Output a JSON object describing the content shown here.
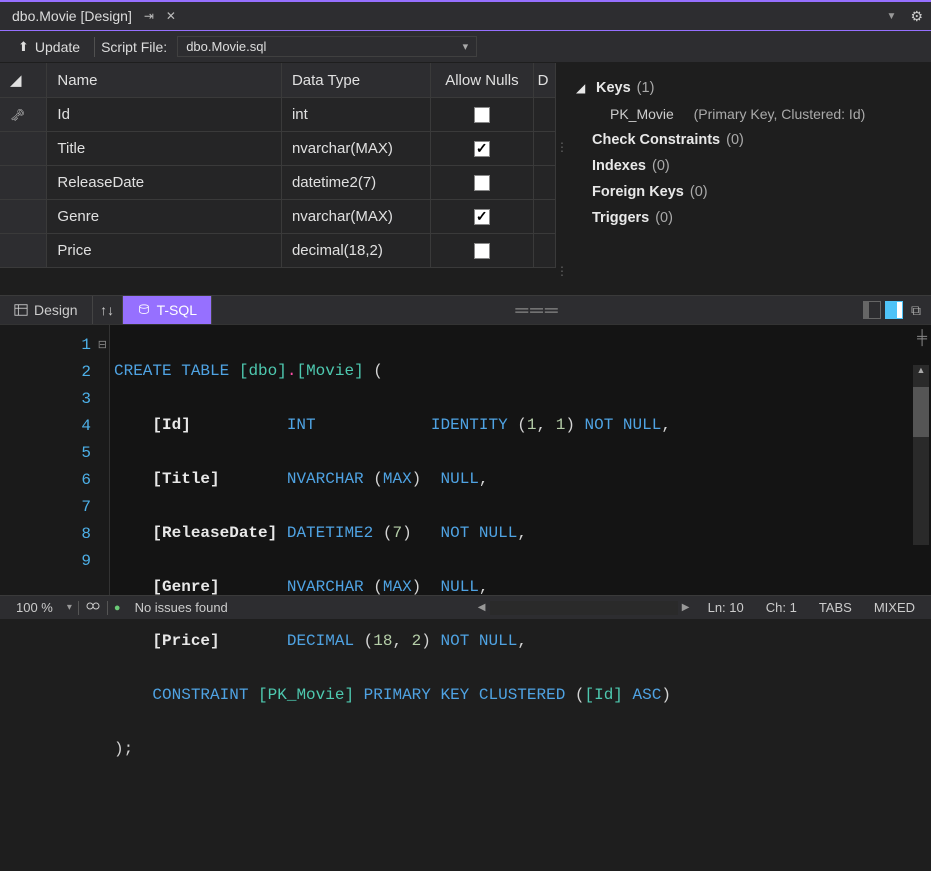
{
  "titlebar": {
    "tab_title": "dbo.Movie [Design]"
  },
  "toolbar": {
    "update_label": "Update",
    "script_file_label": "Script File:",
    "script_file_value": "dbo.Movie.sql"
  },
  "grid": {
    "headers": {
      "name": "Name",
      "type": "Data Type",
      "nulls": "Allow Nulls",
      "default": "D"
    },
    "rows": [
      {
        "key": true,
        "name": "Id",
        "type": "int",
        "nulls": false
      },
      {
        "key": false,
        "name": "Title",
        "type": "nvarchar(MAX)",
        "nulls": true
      },
      {
        "key": false,
        "name": "ReleaseDate",
        "type": "datetime2(7)",
        "nulls": false
      },
      {
        "key": false,
        "name": "Genre",
        "type": "nvarchar(MAX)",
        "nulls": true
      },
      {
        "key": false,
        "name": "Price",
        "type": "decimal(18,2)",
        "nulls": false
      }
    ]
  },
  "props": {
    "keys_label": "Keys",
    "keys_count": "(1)",
    "pk_name": "PK_Movie",
    "pk_detail": "(Primary Key, Clustered: Id)",
    "check_constraints_label": "Check Constraints",
    "check_constraints_count": "(0)",
    "indexes_label": "Indexes",
    "indexes_count": "(0)",
    "foreign_keys_label": "Foreign Keys",
    "foreign_keys_count": "(0)",
    "triggers_label": "Triggers",
    "triggers_count": "(0)"
  },
  "bottom_tabs": {
    "design": "Design",
    "tsql": "T-SQL"
  },
  "editor": {
    "lines": {
      "l1_a": "CREATE",
      "l1_b": "TABLE",
      "l1_c": "[dbo]",
      "l1_d": ".",
      "l1_e": "[Movie]",
      "l1_f": " (",
      "l2_a": "[Id]",
      "l2_b": "INT",
      "l2_c": "IDENTITY",
      "l2_d": "(",
      "l2_e": "1",
      "l2_f": ", ",
      "l2_g": "1",
      "l2_h": ")",
      "l2_i": " NOT",
      "l2_j": " NULL",
      "l2_k": ",",
      "l3_a": "[Title]",
      "l3_b": "NVARCHAR",
      "l3_c": " (",
      "l3_d": "MAX",
      "l3_e": ")",
      "l3_f": "NULL",
      "l3_g": ",",
      "l4_a": "[ReleaseDate]",
      "l4_b": "DATETIME2",
      "l4_c": " (",
      "l4_d": "7",
      "l4_e": ")",
      "l4_f": "NOT",
      "l4_g": " NULL",
      "l4_h": ",",
      "l5_a": "[Genre]",
      "l5_b": "NVARCHAR",
      "l5_c": " (",
      "l5_d": "MAX",
      "l5_e": ")",
      "l5_f": "NULL",
      "l5_g": ",",
      "l6_a": "[Price]",
      "l6_b": "DECIMAL",
      "l6_c": " (",
      "l6_d": "18",
      "l6_e": ", ",
      "l6_f": "2",
      "l6_g": ")",
      "l6_h": " NOT",
      "l6_i": " NULL",
      "l6_j": ",",
      "l7_a": "CONSTRAINT",
      "l7_b": "[PK_Movie]",
      "l7_c": "PRIMARY",
      "l7_d": " KEY",
      "l7_e": " CLUSTERED",
      "l7_f": " (",
      "l7_g": "[Id]",
      "l7_h": "ASC",
      "l7_i": ")",
      "l8_a": ");"
    },
    "gutter": [
      "1",
      "2",
      "3",
      "4",
      "5",
      "6",
      "7",
      "8",
      "9"
    ]
  },
  "status": {
    "zoom": "100 %",
    "issues": "No issues found",
    "line": "Ln: 10",
    "col": "Ch: 1",
    "tabs": "TABS",
    "mixed": "MIXED"
  }
}
